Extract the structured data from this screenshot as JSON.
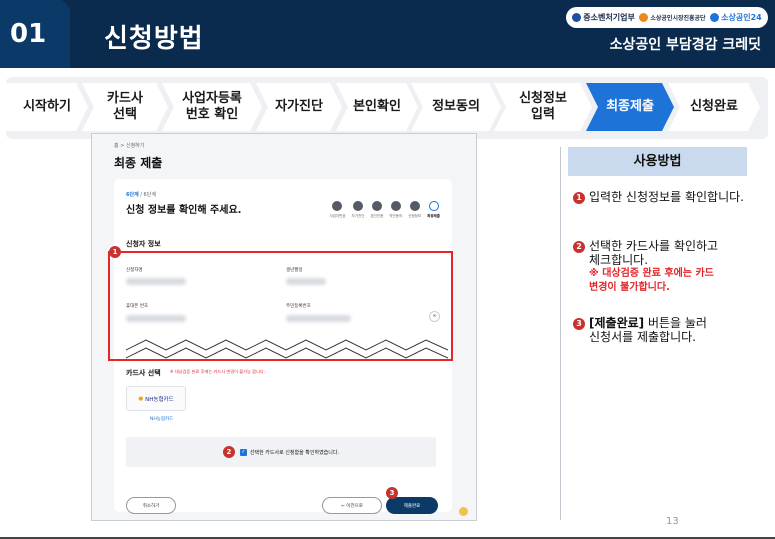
{
  "header": {
    "number": "01",
    "title": "신청방법",
    "subtitle": "소상공인 부담경감 크레딧",
    "logos": [
      "중소벤처기업부",
      "소상공인시장진흥공단",
      "소상공인24"
    ]
  },
  "steps": [
    {
      "label": "시작하기",
      "active": false
    },
    {
      "label": "카드사\n선택",
      "active": false
    },
    {
      "label": "사업자등록\n번호 확인",
      "active": false
    },
    {
      "label": "자가진단",
      "active": false
    },
    {
      "label": "본인확인",
      "active": false
    },
    {
      "label": "정보동의",
      "active": false
    },
    {
      "label": "신청정보\n입력",
      "active": false
    },
    {
      "label": "최종제출",
      "active": true
    },
    {
      "label": "신청완료",
      "active": false
    }
  ],
  "screen": {
    "breadcrumb": "홈  >  신청하기",
    "page_title": "최종 제출",
    "step_count_current": "6단계",
    "step_count_total": " / 6단계",
    "card_heading": "신청 정보를 확인해 주세요.",
    "mini_steps": [
      "사업자번호",
      "자가진단",
      "본인인증",
      "약관동의",
      "신청정보",
      "최종제출"
    ],
    "section_applicant": "신청자 정보",
    "field_name": "신청자명",
    "field_birth": "생년월일",
    "field_phone": "휴대폰 번호",
    "field_bizno": "주민등록번호",
    "card_select_label": "카드사 선택",
    "card_select_note": "※ 대상검증 완료 후에는 카드사 변경이 불가능 합니다.",
    "card_logo": "NH농협카드",
    "card_name": "NH농협카드",
    "agree_text": "선택한 카드사로 신청함을 확인하였습니다.",
    "btn_cancel": "취소하기",
    "btn_prev": "← 이전으로",
    "btn_submit": "제출완료",
    "badges": [
      "1",
      "2",
      "3"
    ]
  },
  "instructions": {
    "heading": "사용방법",
    "item1_num": "1",
    "item1_text": "입력한 신청정보를 확인합니다.",
    "item2_num": "2",
    "item2_line1": "선택한 카드사를 확인하고",
    "item2_line2": "체크합니다.",
    "item2_warn1": "※ 대상검증 완료 후에는 카드",
    "item2_warn2": "변경이 불가합니다.",
    "item3_num": "3",
    "item3_bold": "[제출완료]",
    "item3_line1": " 버튼을 눌러",
    "item3_line2": "신청서를 제출합니다."
  },
  "page_number": "13",
  "colors": {
    "header_bg": "#0a2a4e",
    "active_step": "#1e73d8",
    "highlight_red": "#e4262b",
    "badge_red": "#c8322e"
  }
}
